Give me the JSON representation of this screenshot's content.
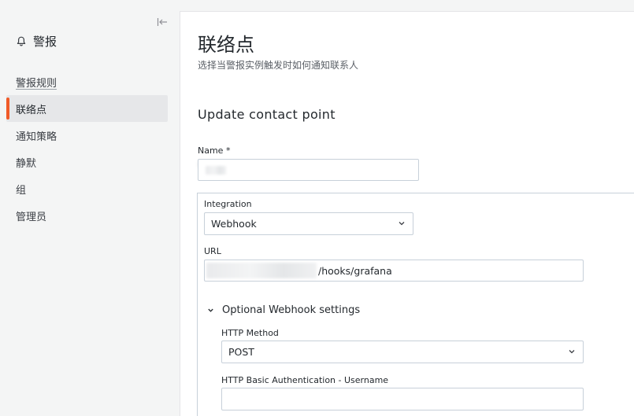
{
  "sidebar": {
    "title": "警报",
    "collapse_icon": "collapse-left-icon",
    "items": [
      {
        "label": "警报规则"
      },
      {
        "label": "联络点"
      },
      {
        "label": "通知策略"
      },
      {
        "label": "静默"
      },
      {
        "label": "组"
      },
      {
        "label": "管理员"
      }
    ]
  },
  "page": {
    "title": "联络点",
    "subtitle": "选择当警报实例触发时如何通知联系人",
    "section_title": "Update contact point"
  },
  "form": {
    "name_label": "Name *",
    "name_value": "",
    "integration_label": "Integration",
    "integration_value": "Webhook",
    "url_label": "URL",
    "url_value": "/hooks/grafana",
    "optional_label": "Optional Webhook settings",
    "http_method_label": "HTTP Method",
    "http_method_value": "POST",
    "basic_auth_label": "HTTP Basic Authentication - Username",
    "basic_auth_value": ""
  },
  "colors": {
    "accent": "#f05a28",
    "border": "#c7d0d9"
  }
}
